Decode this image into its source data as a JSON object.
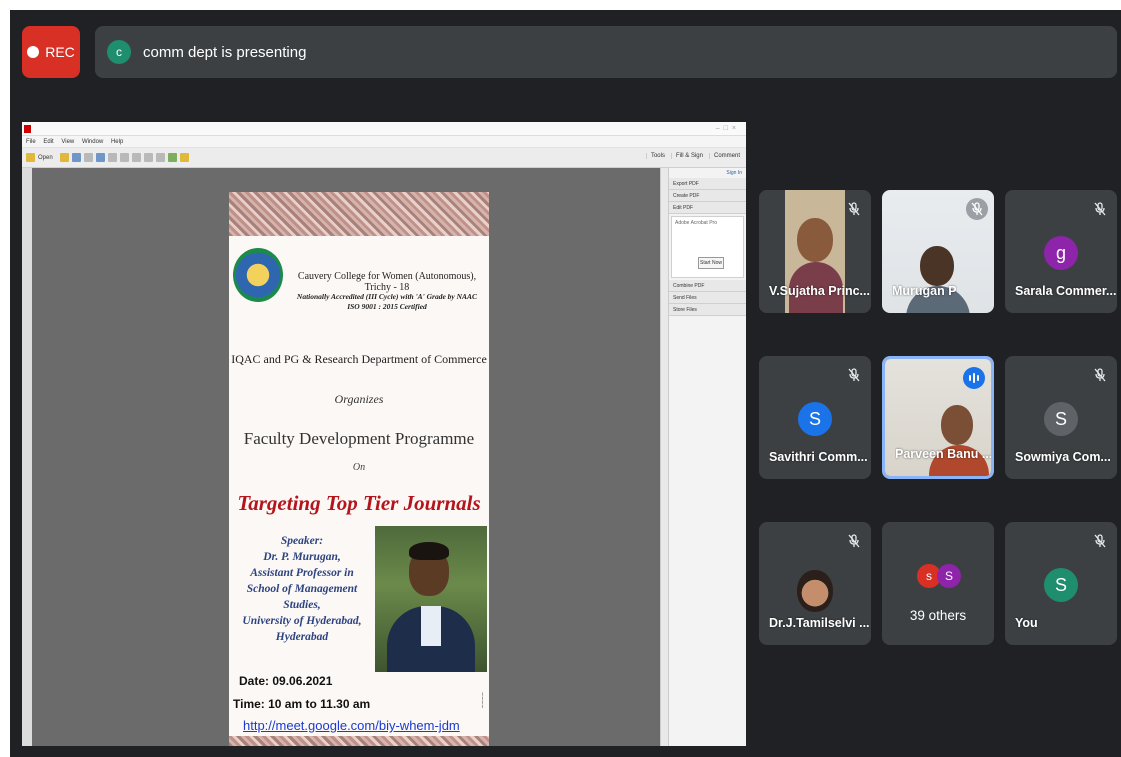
{
  "recording": {
    "label": "REC",
    "color": "#d93025"
  },
  "presenter_bar": {
    "avatar_initial": "c",
    "text": "comm dept is presenting"
  },
  "pdf_viewer": {
    "menu": [
      "File",
      "Edit",
      "View",
      "Window",
      "Help"
    ],
    "open_label": "Open",
    "right_tools": [
      "Tools",
      "Fill & Sign",
      "Comment"
    ],
    "pane_sign_in": "Sign In",
    "pane_items": [
      "Export PDF",
      "Create PDF",
      "Edit PDF"
    ],
    "pane_items_lower": [
      "Combine PDF",
      "Send Files",
      "Store Files"
    ],
    "pane_box_title": "Adobe Acrobat Pro",
    "pane_box_button": "Start Now"
  },
  "poster": {
    "college": "Cauvery College for Women (Autonomous), Trichy - 18",
    "accreditation_1": "Nationally Accredited (III Cycle) with 'A' Grade by NAAC",
    "accreditation_2": "ISO 9001 : 2015 Certified",
    "department": "IQAC and PG & Research Department of Commerce",
    "organises": "Organizes",
    "programme": "Faculty Development Programme",
    "on": "On",
    "headline": "Targeting Top Tier Journals",
    "speaker_lines": [
      "Speaker:",
      "Dr. P. Murugan,",
      "Assistant Professor in",
      "School of Management Studies,",
      "University of Hyderabad,",
      "Hyderabad"
    ],
    "date": "Date: 09.06.2021",
    "time": "Time: 10 am to 11.30 am",
    "link": "http://meet.google.com/biy-whem-jdm"
  },
  "participants": [
    {
      "name": "V.Sujatha Princ...",
      "type": "video",
      "muted": true
    },
    {
      "name": "Murugan P",
      "type": "video",
      "muted": true
    },
    {
      "name": "Sarala Commer...",
      "type": "avatar",
      "initial": "g",
      "avatar_color": "#8e24aa",
      "muted": true
    },
    {
      "name": "Savithri Comm...",
      "type": "avatar",
      "initial": "S",
      "avatar_color": "#1a73e8",
      "muted": true
    },
    {
      "name": "Parveen Banu ...",
      "type": "video",
      "speaking": true
    },
    {
      "name": "Sowmiya Com...",
      "type": "avatar",
      "initial": "S",
      "avatar_color": "#5f6368",
      "muted": true
    },
    {
      "name": "Dr.J.Tamilselvi ...",
      "type": "photo",
      "muted": true
    },
    {
      "name": "39 others",
      "type": "others",
      "initials": [
        "s",
        "S"
      ],
      "avatar_colors": [
        "#d93025",
        "#8e24aa"
      ]
    },
    {
      "name": "You",
      "type": "avatar",
      "initial": "S",
      "avatar_color": "#1e8e6e",
      "muted": true
    }
  ]
}
